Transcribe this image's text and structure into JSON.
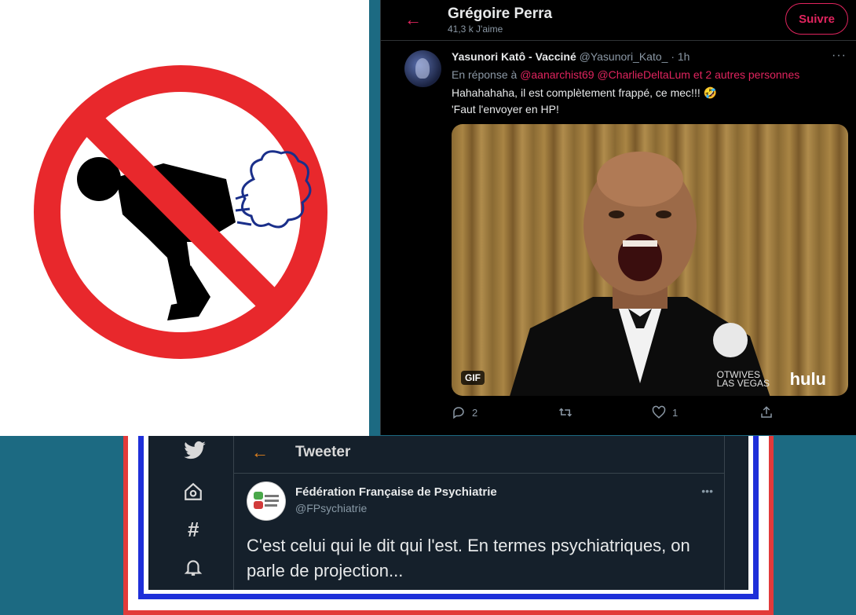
{
  "sign": {
    "icon": "no-farting-sign",
    "colors": {
      "red": "#e8282c",
      "black": "#000000"
    }
  },
  "profile_header": {
    "back_icon": "arrow-left-icon",
    "name": "Grégoire Perra",
    "likes": "41,3 k J'aime",
    "follow_label": "Suivre"
  },
  "tweet": {
    "author_name": "Yasunori Katô - Vacciné",
    "handle": "@Yasunori_Kato_ · 1h",
    "more": "···",
    "reply_prefix": "En réponse à",
    "reply_mentions": "@aanarchist69 @CharlieDeltaLum",
    "reply_suffix": " et 2 autres personnes",
    "text_line1": "Hahahahaha, il est complètement frappé, ce mec!!! 🤣",
    "text_line2": "'Faut l'envoyer en HP!",
    "media": {
      "badge": "GIF",
      "brand_logo": "hulu",
      "overlay_line1": "OTWIVES",
      "overlay_line2": "LAS VEGAS"
    },
    "actions": {
      "replies": "2",
      "likes": "1"
    }
  },
  "embedded": {
    "header_title": "Tweeter",
    "author_name": "Fédération Française de Psychiatrie",
    "handle": "@FPsychiatrie",
    "more": "•••",
    "text": "C'est celui qui le dit qui l'est. En termes psychiatriques, on parle de projection...",
    "frame_colors": {
      "blue": "#1e2fd9",
      "white": "#ffffff",
      "red": "#e23a3a"
    }
  }
}
